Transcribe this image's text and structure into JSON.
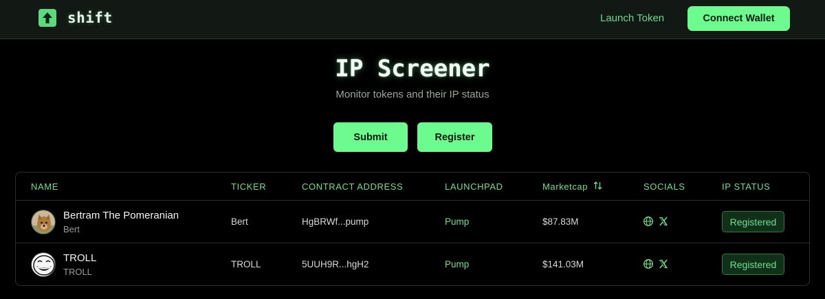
{
  "brand": {
    "name": "shift",
    "accent": "#6dfa8f"
  },
  "nav": {
    "launch_token": "Launch Token",
    "connect_wallet": "Connect Wallet"
  },
  "hero": {
    "title": "IP Screener",
    "subtitle": "Monitor tokens and their IP status",
    "submit_label": "Submit",
    "register_label": "Register"
  },
  "table": {
    "headers": {
      "name": "NAME",
      "ticker": "TICKER",
      "contract": "CONTRACT ADDRESS",
      "launchpad": "LAUNCHPAD",
      "marketcap": "Marketcap",
      "socials": "SOCIALS",
      "ip_status": "IP STATUS"
    },
    "rows": [
      {
        "name": "Bertram The Pomeranian",
        "symbol": "Bert",
        "ticker": "Bert",
        "contract": "HgBRWf...pump",
        "launchpad": "Pump",
        "marketcap": "$87.83M",
        "socials": [
          "globe-icon",
          "x-icon"
        ],
        "ip_status": "Registered",
        "avatar": "dog-avatar"
      },
      {
        "name": "TROLL",
        "symbol": "TROLL",
        "ticker": "TROLL",
        "contract": "5UUH9R...hgH2",
        "launchpad": "Pump",
        "marketcap": "$141.03M",
        "socials": [
          "globe-icon",
          "x-icon"
        ],
        "ip_status": "Registered",
        "avatar": "trollface-avatar"
      }
    ]
  }
}
